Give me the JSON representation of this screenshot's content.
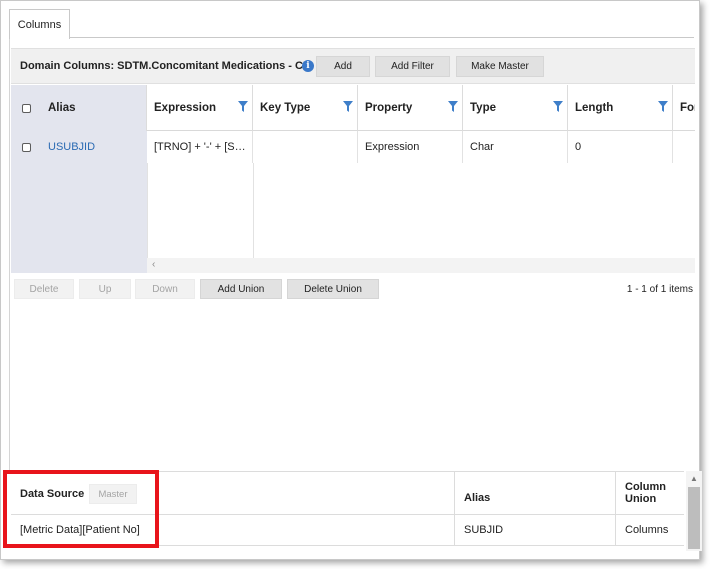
{
  "tabs": [
    {
      "label": "Columns"
    }
  ],
  "toolbar": {
    "title": "Domain Columns: SDTM.Concomitant Medications - CM",
    "info_icon": "info-icon",
    "buttons": {
      "add": "Add",
      "add_filter": "Add Filter",
      "make_master": "Make Master"
    }
  },
  "grid": {
    "columns": [
      "Alias",
      "Expression",
      "Key Type",
      "Property",
      "Type",
      "Length",
      "For"
    ],
    "rows": [
      {
        "alias": "USUBJID",
        "expression": "[TRNO] + '-' + [S…",
        "key_type": "",
        "property": "Expression",
        "type": "Char",
        "length": "0"
      }
    ],
    "scroll_left_glyph": "‹"
  },
  "actions": {
    "delete": "Delete",
    "up": "Up",
    "down": "Down",
    "add_union": "Add Union",
    "delete_union": "Delete Union",
    "pager": "1 - 1 of 1 items"
  },
  "data_source": {
    "header": "Data Source",
    "master_button": "Master",
    "columns": {
      "alias": "Alias",
      "column_union": "Column Union"
    },
    "rows": [
      {
        "source": "[Metric Data][Patient No]",
        "alias": "SUBJID",
        "column_union": "Columns"
      }
    ]
  },
  "colors": {
    "highlight": "#e8141b",
    "link": "#2a6ab3",
    "filter_icon": "#3f7fc9",
    "info_icon": "#3a78c9"
  }
}
